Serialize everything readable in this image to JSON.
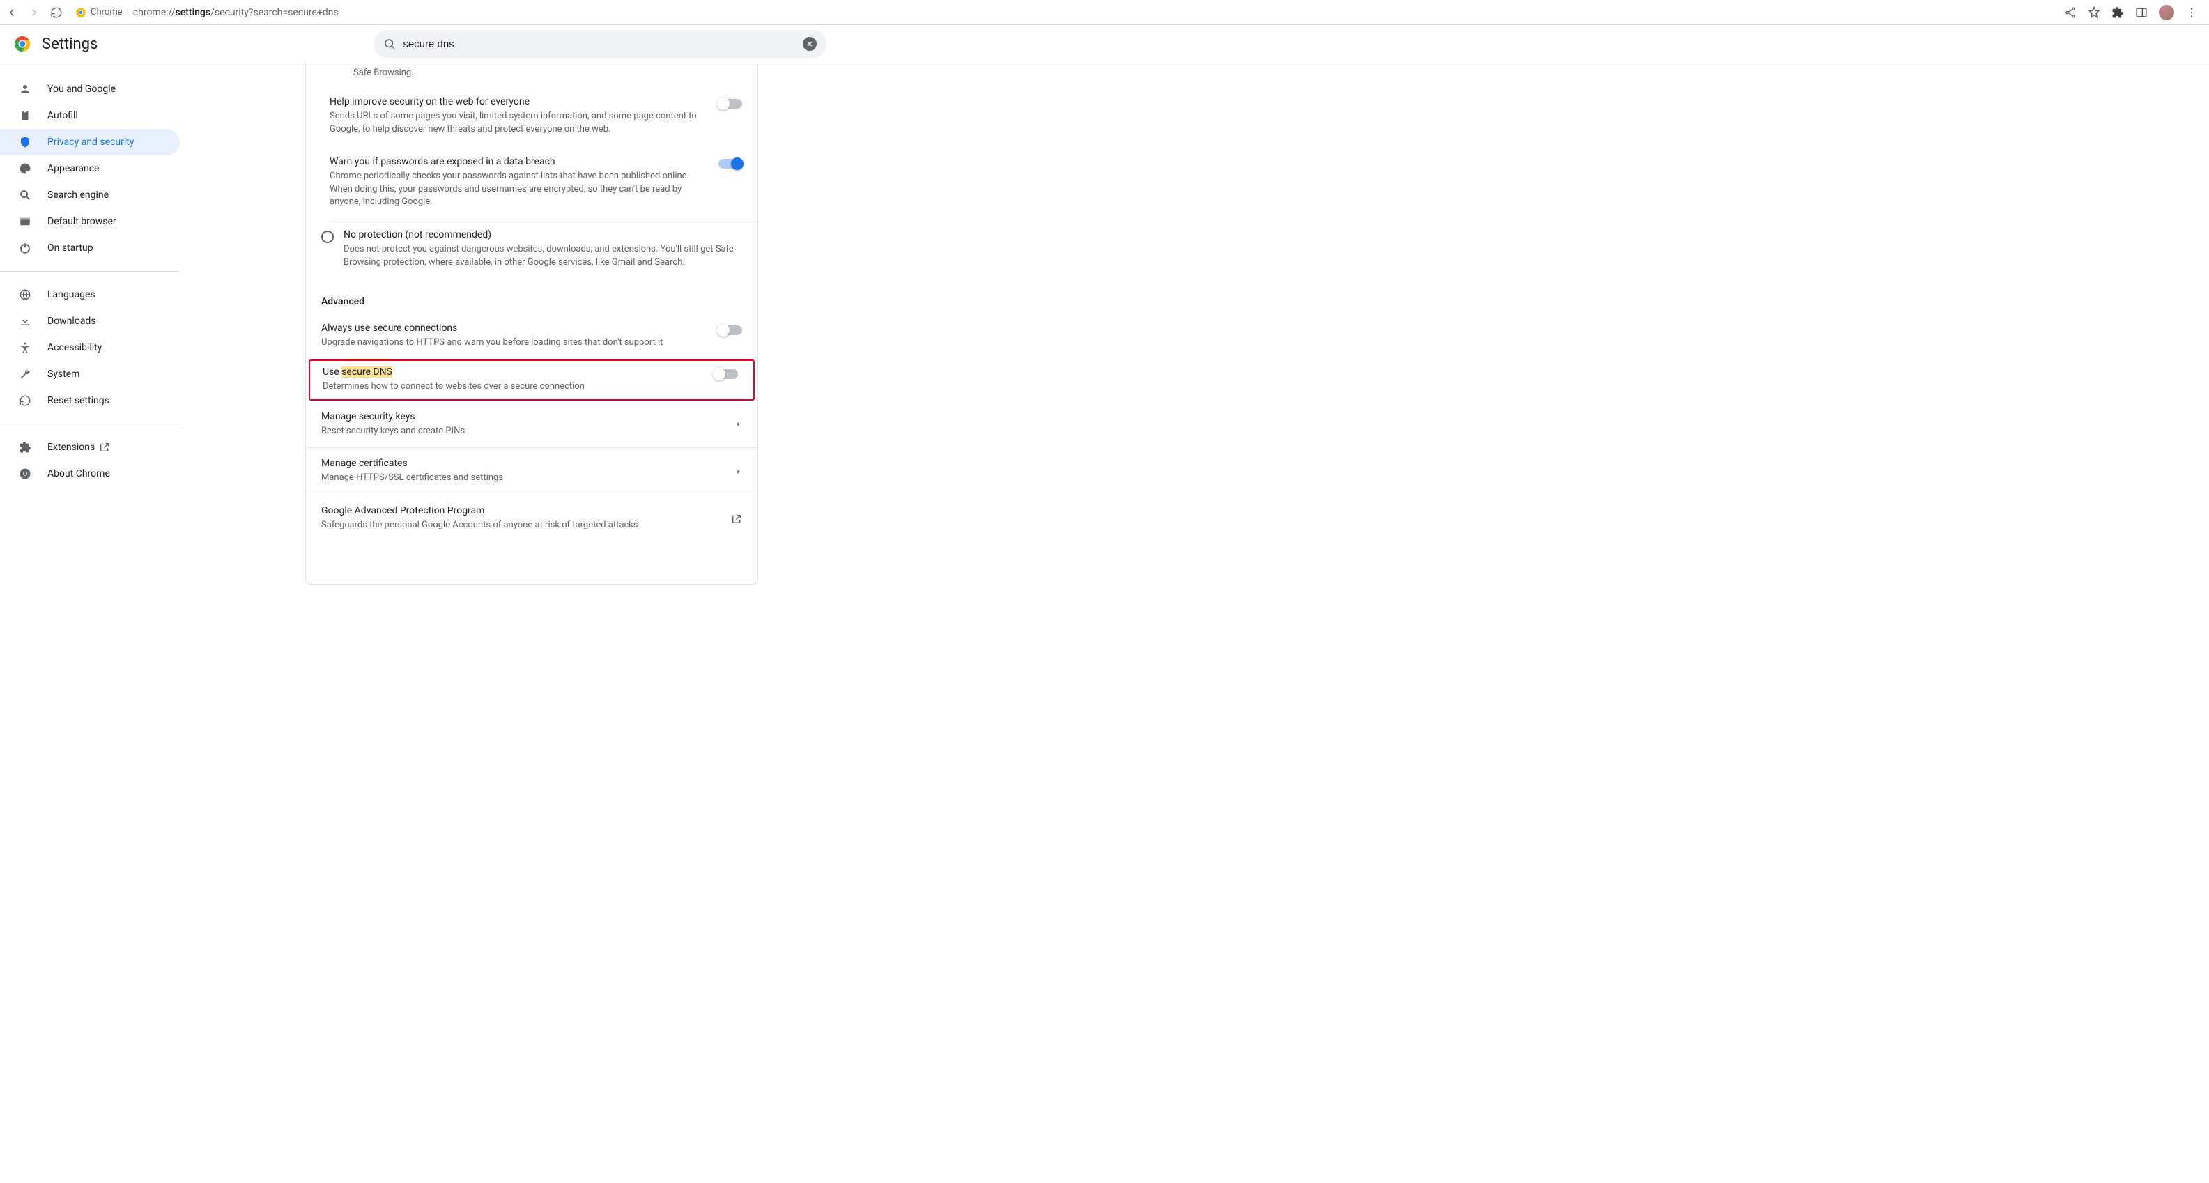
{
  "browser": {
    "url_prefix": "chrome://",
    "url_bold": "settings",
    "url_suffix": "/security?search=secure+dns"
  },
  "header": {
    "title": "Settings",
    "search_value": "secure dns"
  },
  "sidebar": {
    "items": [
      {
        "label": "You and Google"
      },
      {
        "label": "Autofill"
      },
      {
        "label": "Privacy and security"
      },
      {
        "label": "Appearance"
      },
      {
        "label": "Search engine"
      },
      {
        "label": "Default browser"
      },
      {
        "label": "On startup"
      }
    ],
    "items2": [
      {
        "label": "Languages"
      },
      {
        "label": "Downloads"
      },
      {
        "label": "Accessibility"
      },
      {
        "label": "System"
      },
      {
        "label": "Reset settings"
      }
    ],
    "items3": [
      {
        "label": "Extensions"
      },
      {
        "label": "About Chrome"
      }
    ]
  },
  "content": {
    "fragment_top": "Safe Browsing.",
    "help_improve": {
      "title": "Help improve security on the web for everyone",
      "desc": "Sends URLs of some pages you visit, limited system information, and some page content to Google, to help discover new threats and protect everyone on the web.",
      "toggle": false
    },
    "warn_breach": {
      "title": "Warn you if passwords are exposed in a data breach",
      "desc": "Chrome periodically checks your passwords against lists that have been published online. When doing this, your passwords and usernames are encrypted, so they can't be read by anyone, including Google.",
      "toggle": true
    },
    "no_protection": {
      "title": "No protection (not recommended)",
      "desc": "Does not protect you against dangerous websites, downloads, and extensions. You'll still get Safe Browsing protection, where available, in other Google services, like Gmail and Search."
    },
    "advanced_header": "Advanced",
    "always_secure": {
      "title": "Always use secure connections",
      "desc": "Upgrade navigations to HTTPS and warn you before loading sites that don't support it",
      "toggle": false
    },
    "secure_dns": {
      "title_pre": "Use ",
      "title_highlight": "secure DNS",
      "desc": "Determines how to connect to websites over a secure connection",
      "toggle": false
    },
    "manage_keys": {
      "title": "Manage security keys",
      "desc": "Reset security keys and create PINs"
    },
    "manage_certs": {
      "title": "Manage certificates",
      "desc": "Manage HTTPS/SSL certificates and settings"
    },
    "adv_protection": {
      "title": "Google Advanced Protection Program",
      "desc": "Safeguards the personal Google Accounts of anyone at risk of targeted attacks"
    }
  }
}
